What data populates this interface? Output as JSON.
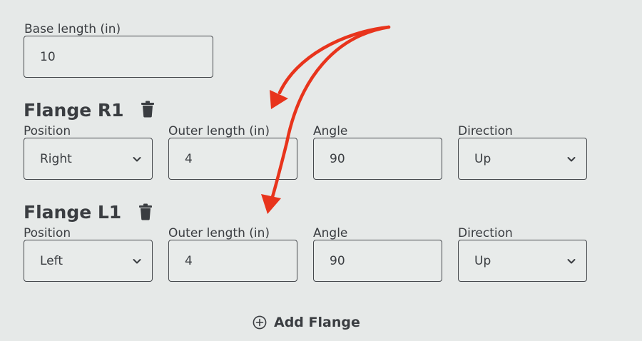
{
  "base": {
    "label": "Base length (in)",
    "value": "10"
  },
  "flanges": [
    {
      "title": "Flange R1",
      "position_label": "Position",
      "position_value": "Right",
      "outer_label": "Outer length (in)",
      "outer_value": "4",
      "angle_label": "Angle",
      "angle_value": "90",
      "direction_label": "Direction",
      "direction_value": "Up"
    },
    {
      "title": "Flange L1",
      "position_label": "Position",
      "position_value": "Left",
      "outer_label": "Outer length (in)",
      "outer_value": "4",
      "angle_label": "Angle",
      "angle_value": "90",
      "direction_label": "Direction",
      "direction_value": "Up"
    }
  ],
  "add_flange": {
    "label": "Add Flange",
    "icon": "plus-circle-icon"
  },
  "icons": {
    "delete": "trash-icon",
    "dropdown": "chevron-down-icon"
  },
  "colors": {
    "background": "#e6e9e8",
    "border": "#45484c",
    "text": "#3a3d41",
    "annotation_arrow": "#e8341c"
  }
}
